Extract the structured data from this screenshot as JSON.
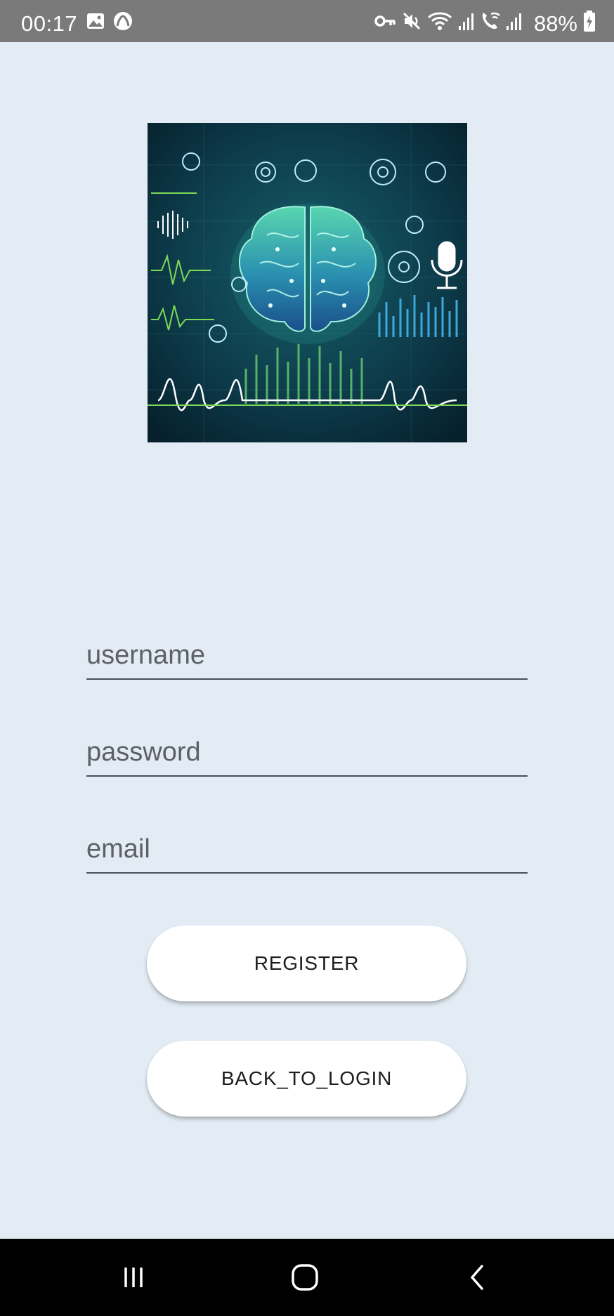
{
  "status_bar": {
    "time": "00:17",
    "battery": "88%",
    "icons": [
      "gallery-icon",
      "app-notification-icon",
      "vpn-key-icon",
      "mute-icon",
      "wifi-icon",
      "signal-icon",
      "wifi-calling-icon",
      "signal-icon",
      "battery-charging-icon"
    ]
  },
  "hero": {
    "icon": "brain-soundwave-illustration",
    "colors": {
      "background": "#0d3b4a",
      "accent": "#3ec9a7",
      "wave": "#7ed957"
    }
  },
  "form": {
    "username_placeholder": "username",
    "password_placeholder": "password",
    "email_placeholder": "email",
    "username_value": "",
    "password_value": "",
    "email_value": ""
  },
  "buttons": {
    "register_label": "REGISTER",
    "back_to_login_label": "BACK_TO_LOGIN"
  },
  "nav_bar": {
    "icons": [
      "recent-apps-icon",
      "home-icon",
      "back-icon"
    ]
  },
  "colors": {
    "page_background": "#e3ecf5",
    "status_bar": "#7a7a7a",
    "button_background": "#ffffff",
    "nav_bar": "#000000"
  }
}
